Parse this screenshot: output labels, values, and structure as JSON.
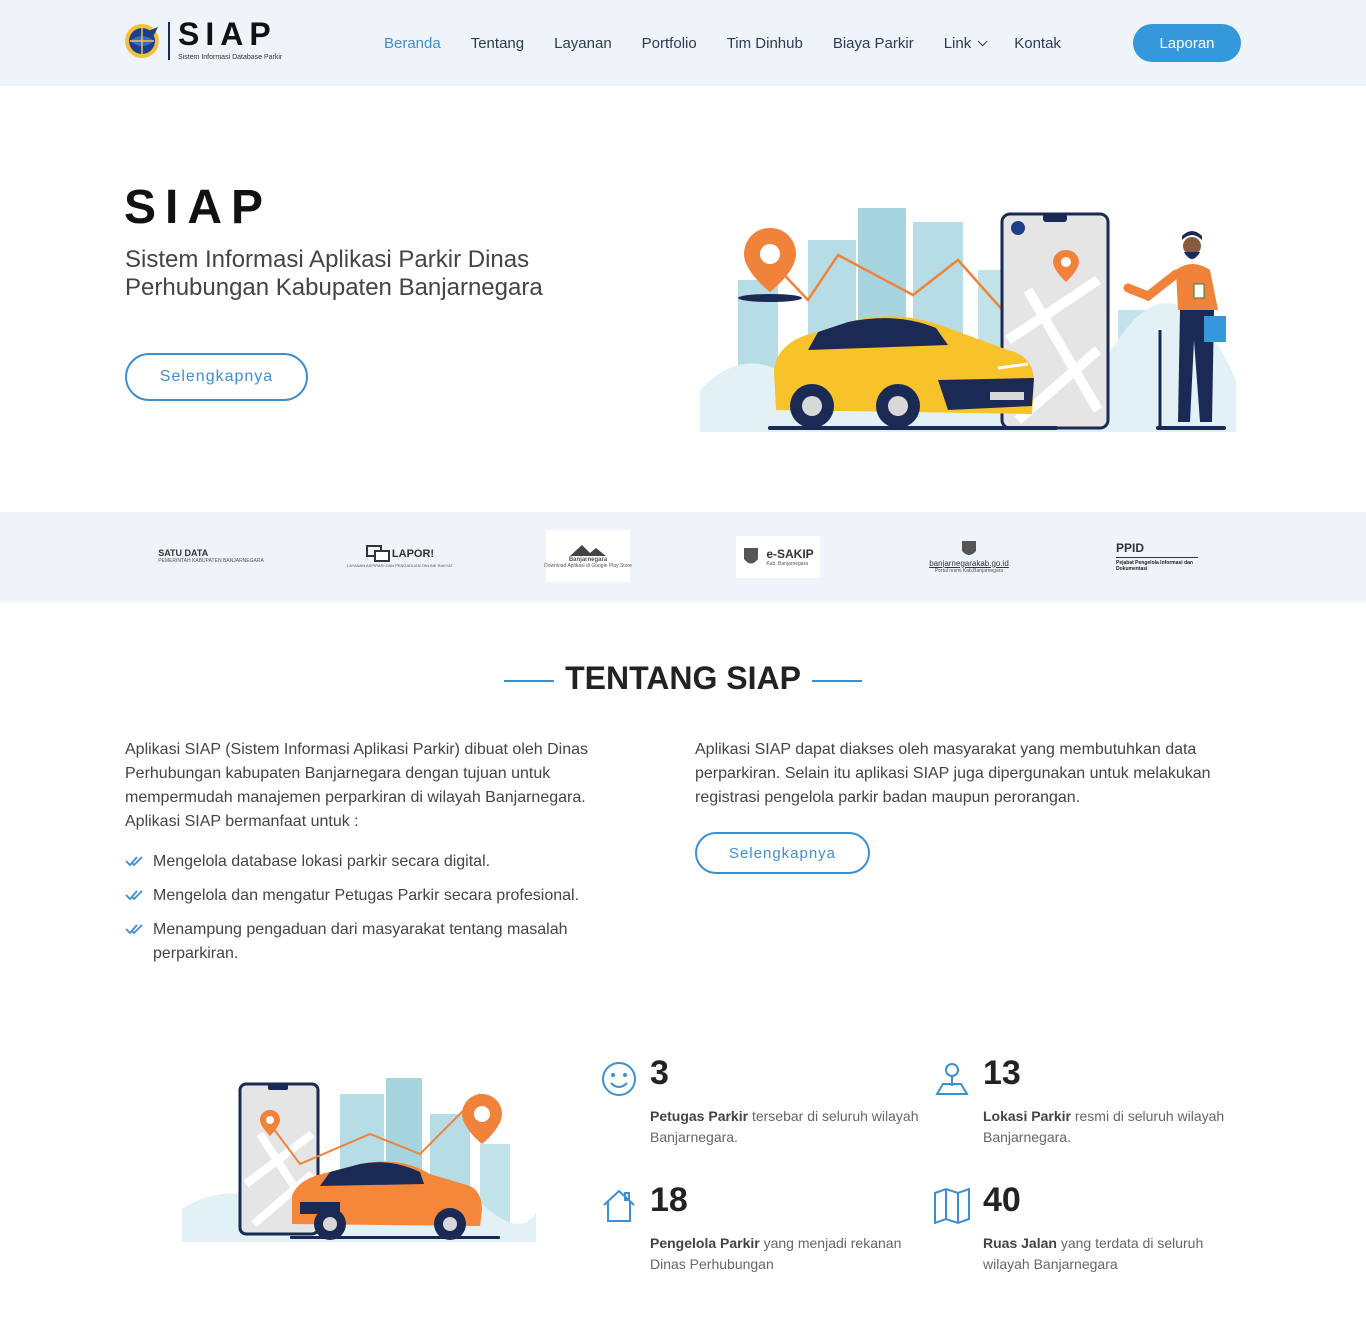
{
  "header": {
    "logo_title": "SIAP",
    "logo_subtitle": "Sistem Informasi Database Parkir",
    "nav": [
      {
        "label": "Beranda",
        "active": true
      },
      {
        "label": "Tentang"
      },
      {
        "label": "Layanan"
      },
      {
        "label": "Portfolio"
      },
      {
        "label": "Tim Dinhub"
      },
      {
        "label": "Biaya Parkir"
      },
      {
        "label": "Link",
        "dropdown": true
      },
      {
        "label": "Kontak"
      }
    ],
    "cta_label": "Laporan"
  },
  "hero": {
    "title": "SIAP",
    "subtitle": "Sistem Informasi Aplikasi Parkir Dinas Perhubungan Kabupaten Banjarnegara",
    "button_label": "Selengkapnya"
  },
  "clients": [
    {
      "label": "SATU DATA",
      "sub": "PEMERINTAH KABUPATEN BANJARNEGARA"
    },
    {
      "label": "LAPOR!",
      "sub": "LAYANAN ASPIRASI DAN PENGADUAN ONLINE RAKYAT"
    },
    {
      "label": "Banjarnegara",
      "sub": "Download Aplikasi di Google Play Store"
    },
    {
      "label": "e-SAKIP",
      "sub": "Kab. Banjarnegara"
    },
    {
      "label": "banjarnegarakab.go.id",
      "sub": "Portal resmi Kab.Banjarnegara"
    },
    {
      "label": "PPID",
      "sub": "Pejabat Pengelola Informasi dan Dokumentasi"
    }
  ],
  "about": {
    "title": "TENTANG SIAP",
    "left_text": "Aplikasi SIAP (Sistem Informasi Aplikasi Parkir) dibuat oleh Dinas Perhubungan kabupaten Banjarnegara dengan tujuan untuk mempermudah manajemen perparkiran di wilayah Banjarnegara. Aplikasi SIAP bermanfaat untuk :",
    "list": [
      "Mengelola database lokasi parkir secara digital.",
      "Mengelola dan mengatur Petugas Parkir secara profesional.",
      "Menampung pengaduan dari masyarakat tentang masalah perparkiran."
    ],
    "right_text": "Aplikasi SIAP dapat diakses oleh masyarakat yang membutuhkan data perparkiran. Selain itu aplikasi SIAP juga dipergunakan untuk melakukan registrasi pengelola parkir badan maupun perorangan.",
    "button_label": "Selengkapnya"
  },
  "counts": [
    {
      "icon": "smiley-icon",
      "number": "3",
      "strong": "Petugas Parkir",
      "text": " tersebar di seluruh wilayah Banjarnegara."
    },
    {
      "icon": "location-person-icon",
      "number": "13",
      "strong": "Lokasi Parkir",
      "text": " resmi di seluruh wilayah Banjarnegara."
    },
    {
      "icon": "home-icon",
      "number": "18",
      "strong": "Pengelola Parkir",
      "text": " yang menjadi rekanan Dinas Perhubungan"
    },
    {
      "icon": "map-icon",
      "number": "40",
      "strong": "Ruas Jalan",
      "text": " yang terdata di seluruh wilayah Banjarnegara"
    }
  ],
  "colors": {
    "accent": "#3d8fd0",
    "header_bg": "#eef4fa",
    "car_yellow": "#f8c22b",
    "car_orange": "#f5873a",
    "pin_orange": "#f0823a"
  }
}
